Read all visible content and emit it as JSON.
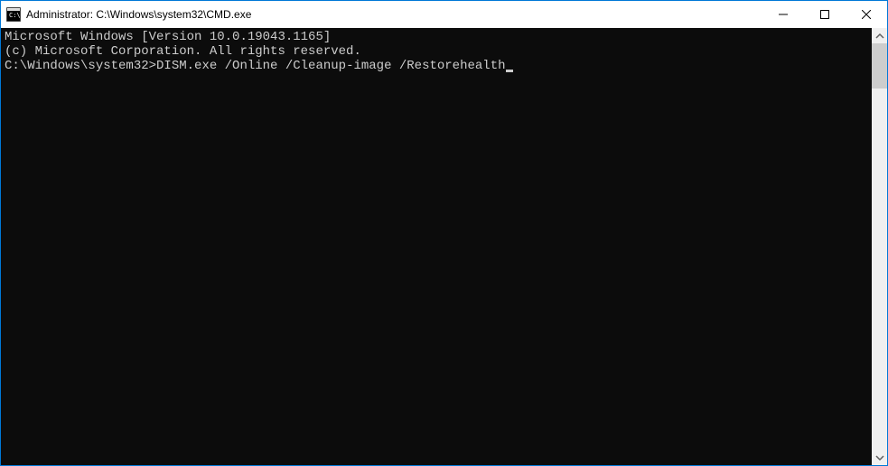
{
  "titlebar": {
    "title": "Administrator: C:\\Windows\\system32\\CMD.exe"
  },
  "console": {
    "line1": "Microsoft Windows [Version 10.0.19043.1165]",
    "line2": "(c) Microsoft Corporation. All rights reserved.",
    "line3": "",
    "prompt": "C:\\Windows\\system32>",
    "command": "DISM.exe /Online /Cleanup-image /Restorehealth"
  }
}
